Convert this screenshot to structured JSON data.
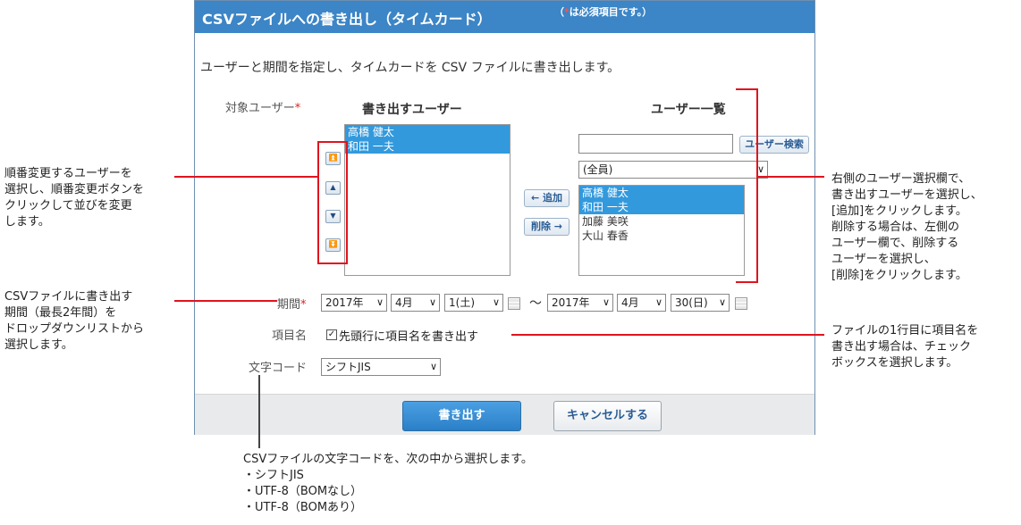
{
  "panel": {
    "title": "CSVファイルへの書き出し（タイムカード）",
    "required_note_prefix": "（",
    "required_note_star": "*",
    "required_note_suffix": "は必須項目です。）",
    "description": "ユーザーと期間を指定し、タイムカードを CSV ファイルに書き出します。"
  },
  "target_users": {
    "label": "対象ユーザー",
    "required_mark": "*",
    "export_column_title": "書き出すユーザー",
    "user_list_title": "ユーザー一覧",
    "export_list": [
      "高橋 健太",
      "和田 一夫"
    ],
    "search_placeholder": "",
    "search_button": "ユーザー検索",
    "group_select": "(全員)",
    "user_list": [
      {
        "name": "高橋 健太",
        "selected": true
      },
      {
        "name": "和田 一夫",
        "selected": true
      },
      {
        "name": "加藤 美咲",
        "selected": false
      },
      {
        "name": "大山 春香",
        "selected": false
      }
    ],
    "add_button": "← 追加",
    "remove_button": "削除 →",
    "order_buttons": [
      "⏫",
      "▲",
      "▼",
      "⏬"
    ]
  },
  "period": {
    "label": "期間",
    "required_mark": "*",
    "start_year": "2017年",
    "start_month": "4月",
    "start_day": "1(土)",
    "separator": "～",
    "end_year": "2017年",
    "end_month": "4月",
    "end_day": "30(日)"
  },
  "item_name": {
    "label": "項目名",
    "checkbox_label": "先頭行に項目名を書き出す",
    "checked": true,
    "check_glyph": "✓"
  },
  "charset": {
    "label": "文字コード",
    "value": "シフトJIS"
  },
  "buttons": {
    "export": "書き出す",
    "cancel": "キャンセルする"
  },
  "annotations": {
    "reorder": "順番変更するユーザーを\n選択し、順番変更ボタンを\nクリックして並びを変更\nします。",
    "period": "CSVファイルに書き出す\n期間（最長2年間）を\nドロップダウンリストから\n選択します。",
    "user_select": "右側のユーザー選択欄で、\n書き出すユーザーを選択し、\n[追加]をクリックします。\n削除する場合は、左側の\nユーザー欄で、削除する\nユーザーを選択し、\n[削除]をクリックします。",
    "header_row": "ファイルの1行目に項目名を\n書き出す場合は、チェック\nボックスを選択します。",
    "charset": "CSVファイルの文字コードを、次の中から選択します。\n・シフトJIS\n・UTF-8（BOMなし）\n・UTF-8（BOMあり）"
  },
  "colors": {
    "header": "#3c85c6",
    "accent_line": "#e0141e",
    "selection": "#3399dd"
  }
}
